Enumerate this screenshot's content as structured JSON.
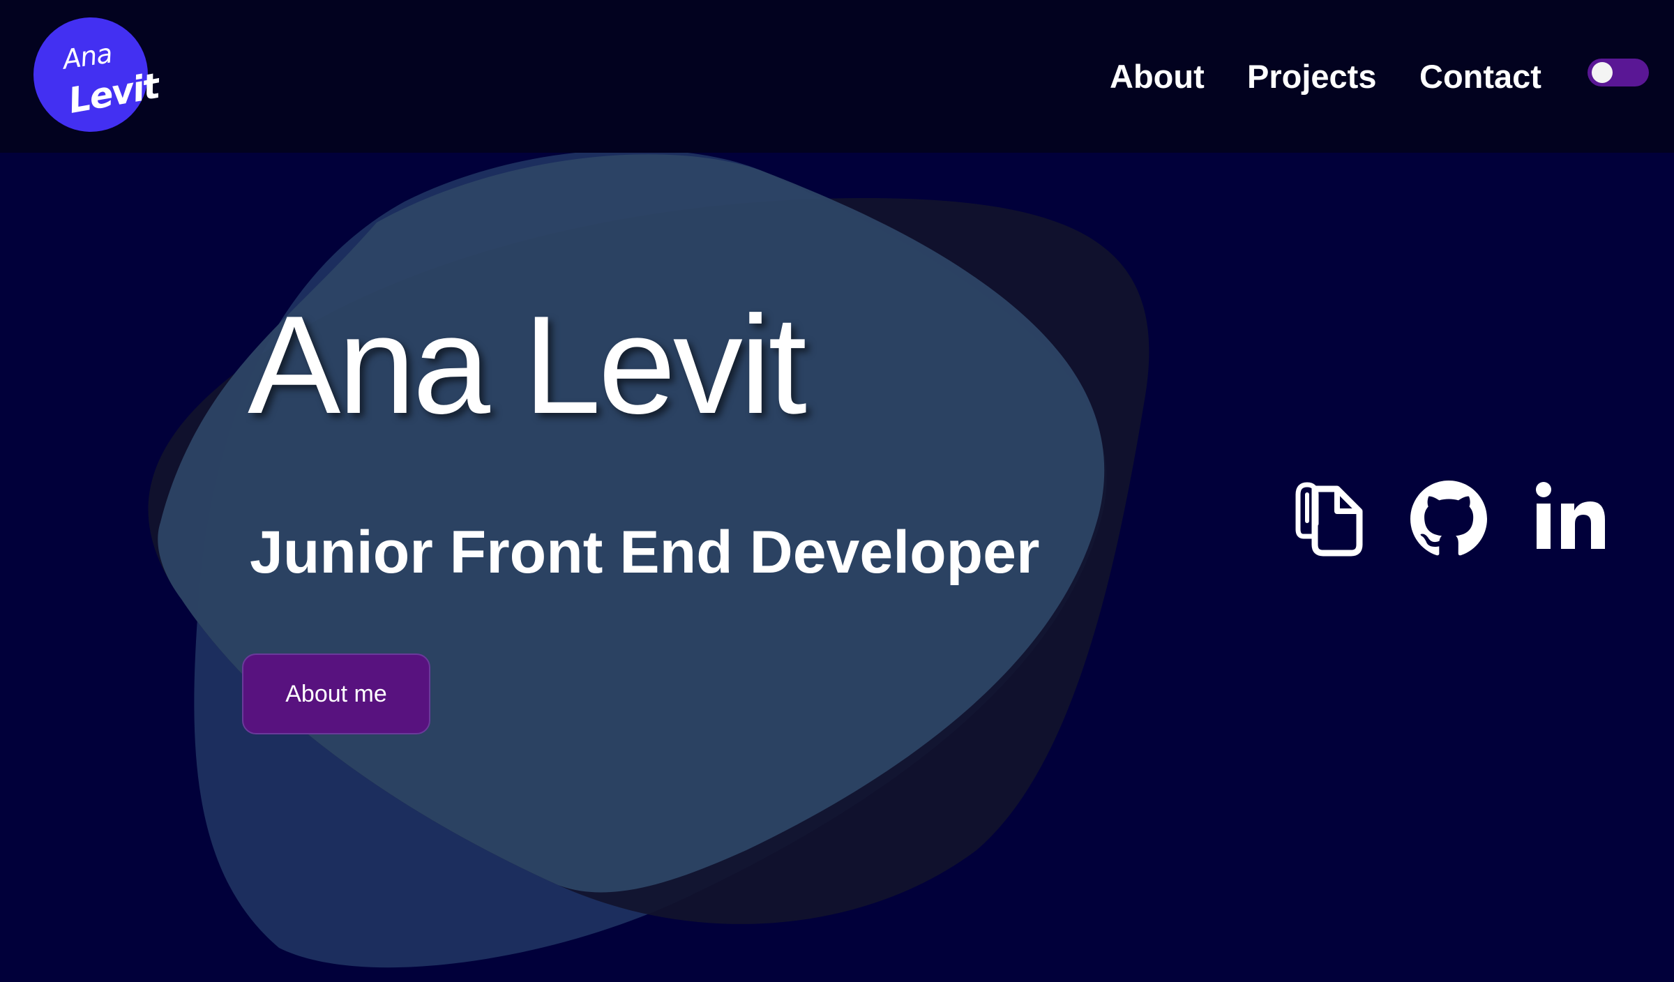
{
  "header": {
    "logo": {
      "line1": "Ana",
      "line2": "Levit"
    },
    "nav": [
      {
        "label": "About"
      },
      {
        "label": "Projects"
      },
      {
        "label": "Contact"
      }
    ],
    "theme_toggle": {
      "state": "off",
      "color": "#5a1795"
    }
  },
  "hero": {
    "name": "Ana Levit",
    "role": "Junior Front End Developer",
    "cta_label": "About me",
    "social_icons": [
      "resume-document-icon",
      "github-icon",
      "linkedin-icon"
    ]
  },
  "colors": {
    "background": "#01003a",
    "navbar": "#02021f",
    "logo": "#4330f2",
    "button": "#58127f",
    "blob_light": "#2d4465",
    "blob_dark": "#12132c",
    "blob_blue": "#1d3060"
  }
}
